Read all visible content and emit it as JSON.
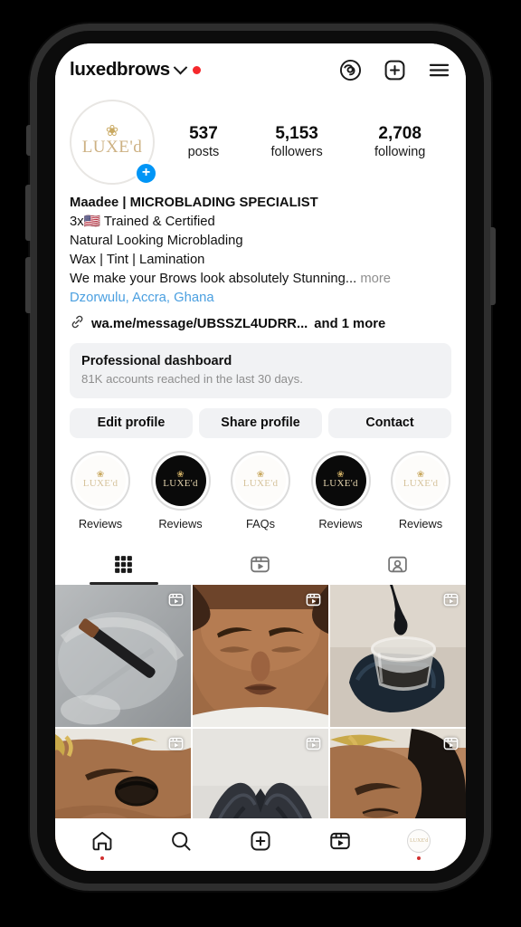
{
  "app": {
    "name": "Instagram",
    "screen": "profile"
  },
  "header": {
    "username": "luxedbrows",
    "chevron_icon": "chevron-down-icon",
    "unread_dot_color": "#f5282c",
    "actions": [
      {
        "name": "threads-icon",
        "label": "Threads"
      },
      {
        "name": "new-post-icon",
        "label": "New post"
      },
      {
        "name": "menu-icon",
        "label": "Menu"
      }
    ]
  },
  "profile": {
    "avatar": {
      "logo_text": "LUXE'd",
      "swirl": "❀",
      "add_story_label": "+"
    },
    "stats": [
      {
        "value": "537",
        "label": "posts"
      },
      {
        "value": "5,153",
        "label": "followers"
      },
      {
        "value": "2,708",
        "label": "following"
      }
    ],
    "bio": {
      "display_name": "Maadee | MICROBLADING SPECIALIST",
      "lines": [
        "3x🇺🇸 Trained & Certified",
        "Natural Looking Microblading",
        "Wax | Tint | Lamination"
      ],
      "truncated_line": "We make your Brows look absolutely Stunning...",
      "more_label": "more",
      "location": "Dzorwulu, Accra, Ghana",
      "link_icon": "link-icon",
      "link_text": "wa.me/message/UBSSZL4UDRR...",
      "link_more": "and 1 more"
    }
  },
  "dashboard": {
    "title": "Professional dashboard",
    "subtitle": "81K accounts reached in the last 30 days."
  },
  "actions": [
    {
      "name": "edit-profile-button",
      "label": "Edit profile"
    },
    {
      "name": "share-profile-button",
      "label": "Share profile"
    },
    {
      "name": "contact-button",
      "label": "Contact"
    }
  ],
  "highlights": [
    {
      "label": "Reviews",
      "style": "light",
      "logo": "LUXE'd"
    },
    {
      "label": "Reviews",
      "style": "dark",
      "logo": "LUXE'd"
    },
    {
      "label": "FAQs",
      "style": "light",
      "logo": "LUXE'd"
    },
    {
      "label": "Reviews",
      "style": "dark",
      "logo": "LUXE'd"
    },
    {
      "label": "Reviews",
      "style": "light",
      "logo": "LUXE'd"
    }
  ],
  "tabs": [
    {
      "name": "tab-grid",
      "icon": "grid-icon",
      "active": true
    },
    {
      "name": "tab-reels",
      "icon": "reels-icon",
      "active": false
    },
    {
      "name": "tab-tagged",
      "icon": "tagged-icon",
      "active": false
    }
  ],
  "grid_posts": [
    {
      "name": "post-brush-pigment",
      "is_reel": true
    },
    {
      "name": "post-client-brows",
      "is_reel": true
    },
    {
      "name": "post-gloved-hand-cup",
      "is_reel": true
    },
    {
      "name": "post-brow-closeup",
      "is_reel": true
    },
    {
      "name": "post-gloved-hands",
      "is_reel": true
    },
    {
      "name": "post-side-profile",
      "is_reel": true
    }
  ],
  "bottom_nav": [
    {
      "name": "nav-home",
      "icon": "home-icon",
      "badge": true
    },
    {
      "name": "nav-search",
      "icon": "search-icon",
      "badge": false
    },
    {
      "name": "nav-create",
      "icon": "create-icon",
      "badge": false
    },
    {
      "name": "nav-reels",
      "icon": "reels-icon",
      "badge": false
    },
    {
      "name": "nav-profile",
      "icon": "avatar-icon",
      "badge": true,
      "logo": "LUXE'd"
    }
  ],
  "colors": {
    "accent_blue": "#0095f6",
    "link_blue": "#4a9fe0",
    "notification_red": "#f5282c",
    "surface_gray": "#f1f2f4",
    "muted_text": "#8e8e8e"
  }
}
